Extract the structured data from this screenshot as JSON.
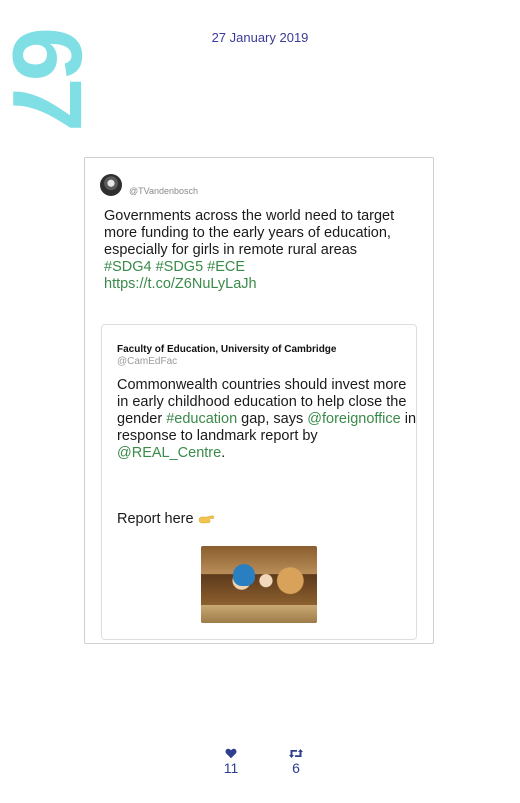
{
  "page": {
    "number": "67",
    "date": "27 January 2019"
  },
  "tweet": {
    "handle": "@TVandenbosch",
    "text": "Governments across the world need to target more funding to the early years of education, especially for girls in remote rural areas",
    "hashtags": "#SDG4 #SDG5 #ECE",
    "link": "https://t.co/Z6NuLyLaJh",
    "quoted": {
      "name": "Faculty of Education, University of Cambridge",
      "handle": "@CamEdFac",
      "text_part1": "Commonwealth countries should invest more in early childhood education to help close the gender ",
      "hashtag": "#education",
      "text_part2": " gap, says ",
      "mention1": "@foreignoffice",
      "text_part3": " in response to landmark report by ",
      "mention2": "@REAL_Centre",
      "text_part4": ".",
      "report_label": "Report here"
    }
  },
  "stats": {
    "likes": "11",
    "retweets": "6"
  },
  "colors": {
    "accent_green": "#3a8a4a",
    "date_blue": "#3a3a9a",
    "page_number": "#7fdfe4",
    "stat_blue": "#2f3f8f"
  },
  "icons": {
    "like": "heart-icon",
    "retweet": "retweet-icon",
    "report": "pointing-hand-icon"
  }
}
